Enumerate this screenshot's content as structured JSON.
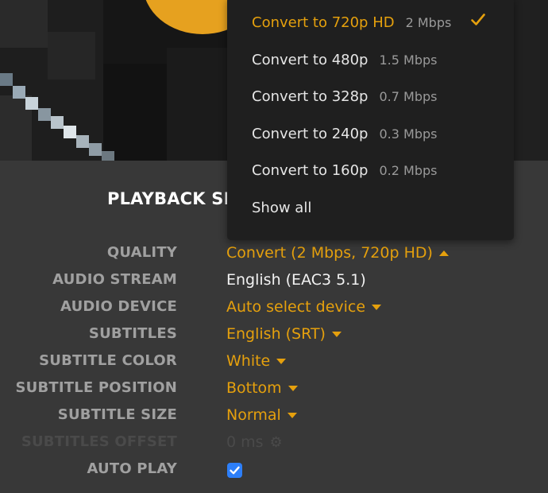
{
  "settings": {
    "title": "PLAYBACK SE",
    "rows": [
      {
        "label": "QUALITY",
        "value": "Convert (2 Mbps, 720p HD)"
      },
      {
        "label": "AUDIO STREAM",
        "value": "English (EAC3 5.1)"
      },
      {
        "label": "AUDIO DEVICE",
        "value": "Auto select device"
      },
      {
        "label": "SUBTITLES",
        "value": "English (SRT)"
      },
      {
        "label": "SUBTITLE COLOR",
        "value": "White"
      },
      {
        "label": "SUBTITLE POSITION",
        "value": "Bottom"
      },
      {
        "label": "SUBTITLE SIZE",
        "value": "Normal"
      },
      {
        "label": "SUBTITLES OFFSET",
        "value": "0 ms"
      },
      {
        "label": "AUTO PLAY",
        "checked": true
      }
    ]
  },
  "quality_menu": {
    "options": [
      {
        "label": "Convert to 720p HD",
        "rate": "2 Mbps",
        "selected": true
      },
      {
        "label": "Convert to 480p",
        "rate": "1.5 Mbps"
      },
      {
        "label": "Convert to 328p",
        "rate": "0.7 Mbps"
      },
      {
        "label": "Convert to 240p",
        "rate": "0.3 Mbps"
      },
      {
        "label": "Convert to 160p",
        "rate": "0.2 Mbps"
      }
    ],
    "show_all": "Show all"
  },
  "colors": {
    "accent": "#e5a00d",
    "checkbox": "#2d7ff9",
    "menu_bg": "#1f1f1f"
  }
}
